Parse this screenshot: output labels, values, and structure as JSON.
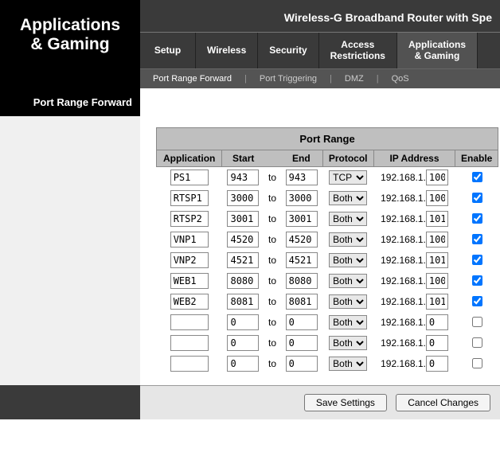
{
  "product_title": "Wireless-G Broadband Router with Spe",
  "brand": {
    "line1": "Applications",
    "line2": "& Gaming"
  },
  "main_tabs": [
    {
      "label": "Setup"
    },
    {
      "label": "Wireless"
    },
    {
      "label": "Security"
    },
    {
      "label_l1": "Access",
      "label_l2": "Restrictions"
    },
    {
      "label_l1": "Applications",
      "label_l2": "& Gaming",
      "active": true
    }
  ],
  "sub_tabs": [
    {
      "label": "Port Range Forward",
      "active": true
    },
    {
      "label": "Port Triggering"
    },
    {
      "label": "DMZ"
    },
    {
      "label": "QoS"
    }
  ],
  "side_label": "Port Range Forward",
  "table": {
    "title": "Port Range",
    "headers": {
      "application": "Application",
      "start": "Start",
      "end": "End",
      "protocol": "Protocol",
      "ip": "IP Address",
      "enable": "Enable"
    },
    "to_label": "to",
    "ip_prefix": "192.168.1.",
    "rows": [
      {
        "app": "PS1",
        "start": "943",
        "end": "943",
        "proto": "TCP",
        "ip": "100",
        "enable": true
      },
      {
        "app": "RTSP1",
        "start": "3000",
        "end": "3000",
        "proto": "Both",
        "ip": "100",
        "enable": true
      },
      {
        "app": "RTSP2",
        "start": "3001",
        "end": "3001",
        "proto": "Both",
        "ip": "101",
        "enable": true
      },
      {
        "app": "VNP1",
        "start": "4520",
        "end": "4520",
        "proto": "Both",
        "ip": "100",
        "enable": true
      },
      {
        "app": "VNP2",
        "start": "4521",
        "end": "4521",
        "proto": "Both",
        "ip": "101",
        "enable": true
      },
      {
        "app": "WEB1",
        "start": "8080",
        "end": "8080",
        "proto": "Both",
        "ip": "100",
        "enable": true
      },
      {
        "app": "WEB2",
        "start": "8081",
        "end": "8081",
        "proto": "Both",
        "ip": "101",
        "enable": true
      },
      {
        "app": "",
        "start": "0",
        "end": "0",
        "proto": "Both",
        "ip": "0",
        "enable": false
      },
      {
        "app": "",
        "start": "0",
        "end": "0",
        "proto": "Both",
        "ip": "0",
        "enable": false
      },
      {
        "app": "",
        "start": "0",
        "end": "0",
        "proto": "Both",
        "ip": "0",
        "enable": false
      }
    ]
  },
  "buttons": {
    "save": "Save Settings",
    "cancel": "Cancel Changes"
  }
}
